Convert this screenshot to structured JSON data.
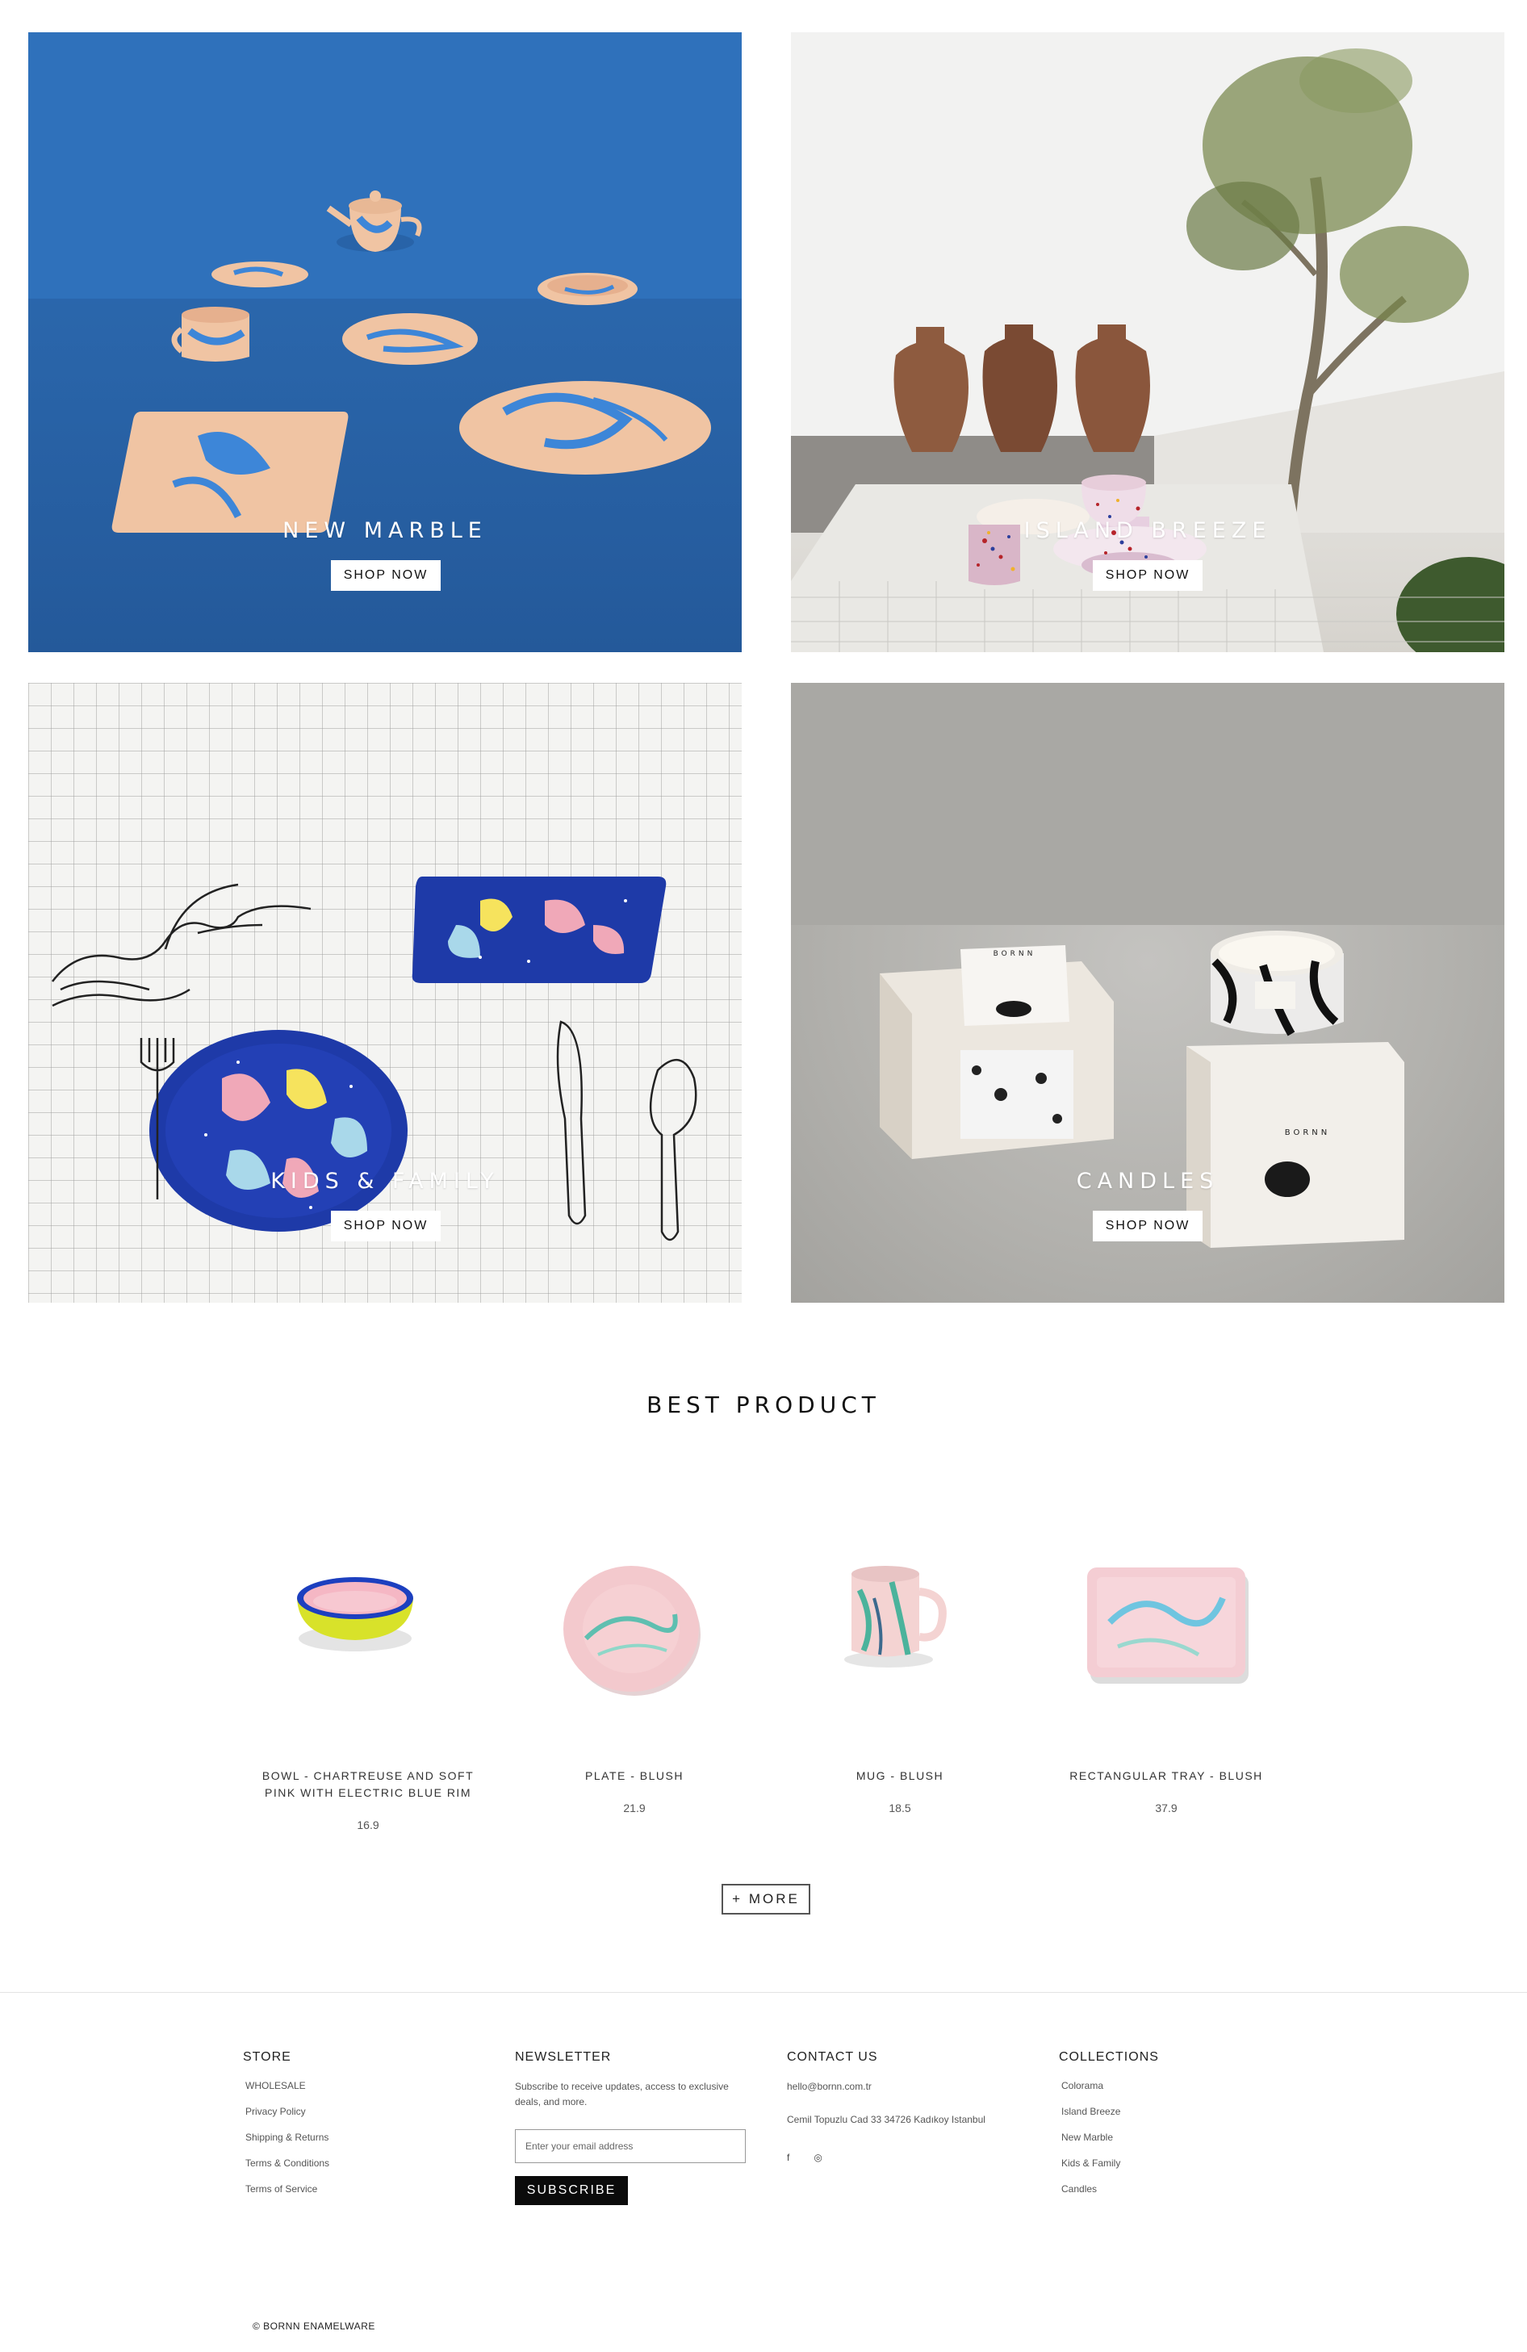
{
  "tiles": [
    {
      "title": "NEW MARBLE",
      "button": "SHOP NOW"
    },
    {
      "title": "ISLAND BREEZE",
      "button": "SHOP NOW"
    },
    {
      "title": "KIDS & FAMILY",
      "button": "SHOP NOW"
    },
    {
      "title": "CANDLES",
      "button": "SHOP NOW"
    }
  ],
  "candle_box_brand": "BORNN",
  "best_product": {
    "title": "BEST PRODUCT",
    "items": [
      {
        "name": "BOWL - CHARTREUSE AND SOFT PINK WITH ELECTRIC BLUE RIM",
        "price": "16.9"
      },
      {
        "name": "PLATE - BLUSH",
        "price": "21.9"
      },
      {
        "name": "MUG - BLUSH",
        "price": "18.5"
      },
      {
        "name": "RECTANGULAR TRAY - BLUSH",
        "price": "37.9"
      }
    ],
    "more_label": "+ MORE"
  },
  "footer": {
    "store": {
      "heading": "STORE",
      "links": [
        "WHOLESALE",
        "Privacy Policy",
        "Shipping & Returns",
        "Terms & Conditions",
        "Terms of Service"
      ]
    },
    "newsletter": {
      "heading": "NEWSLETTER",
      "text": "Subscribe to receive updates, access to exclusive deals, and more.",
      "placeholder": "Enter your email address",
      "button": "SUBSCRIBE"
    },
    "contact": {
      "heading": "CONTACT US",
      "email": "hello@bornn.com.tr",
      "address": "Cemil Topuzlu Cad 33 34726 Kadıkoy Istanbul",
      "social": [
        "f",
        "◎"
      ]
    },
    "collections": {
      "heading": "COLLECTIONS",
      "links": [
        "Colorama",
        "Island Breeze",
        "New Marble",
        "Kids & Family",
        "Candles"
      ]
    },
    "copyright": "© BORNN ENAMELWARE"
  }
}
